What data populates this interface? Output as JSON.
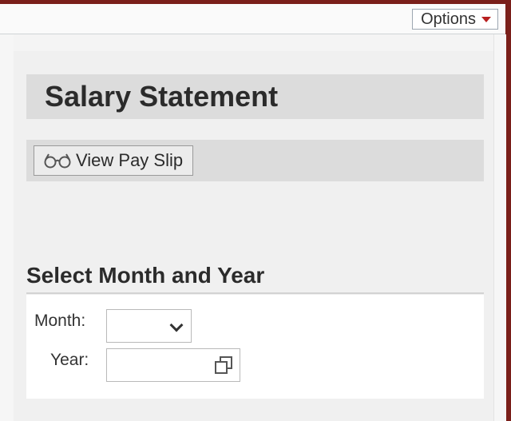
{
  "header": {
    "options_label": "Options"
  },
  "page": {
    "title": "Salary Statement"
  },
  "actions": {
    "view_pay_slip_label": "View Pay Slip"
  },
  "section": {
    "title": "Select Month and Year",
    "fields": {
      "month_label": "Month:",
      "month_value": "",
      "year_label": "Year:",
      "year_value": ""
    }
  },
  "colors": {
    "frame": "#7a1f1a",
    "caret": "#b81f1f",
    "bar": "#dcdcdc"
  },
  "icons": {
    "view": "glasses-icon",
    "options": "caret-down-icon",
    "month": "chevron-down-icon",
    "year": "window-picker-icon"
  }
}
